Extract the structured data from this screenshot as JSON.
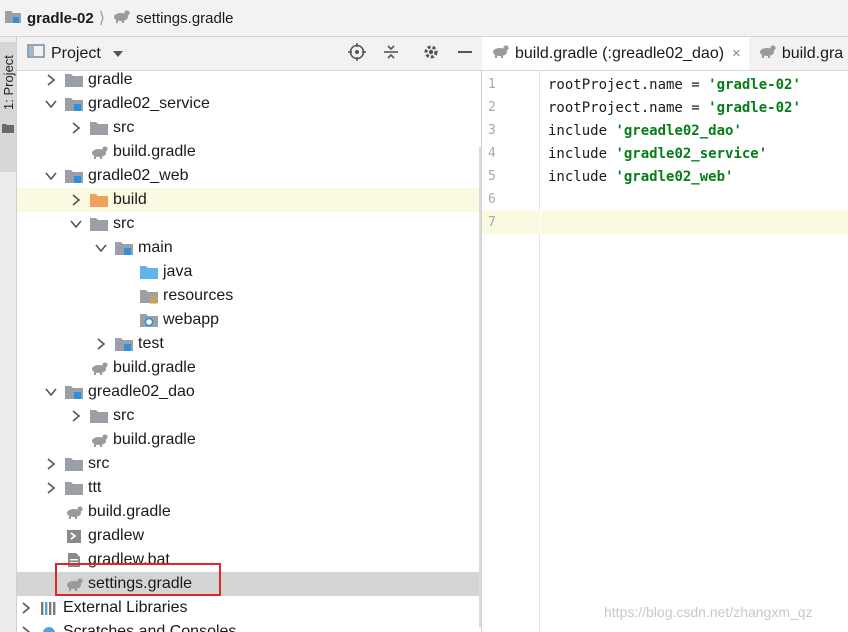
{
  "breadcrumb": {
    "project": "gradle-02",
    "file": "settings.gradle"
  },
  "tool_strip": {
    "project_tab": "1: Project"
  },
  "panel": {
    "title": "Project",
    "tree": [
      {
        "label": "gradle",
        "depth": 1,
        "arrow": "collapsed",
        "icon": "folder-icon"
      },
      {
        "label": "gradle02_service",
        "depth": 1,
        "arrow": "expanded",
        "icon": "module-folder-icon"
      },
      {
        "label": "src",
        "depth": 2,
        "arrow": "collapsed",
        "icon": "folder-icon"
      },
      {
        "label": "build.gradle",
        "depth": 2,
        "arrow": "none",
        "icon": "gradle-icon"
      },
      {
        "label": "gradle02_web",
        "depth": 1,
        "arrow": "expanded",
        "icon": "module-folder-icon"
      },
      {
        "label": "build",
        "depth": 2,
        "arrow": "collapsed",
        "icon": "excluded-folder-icon",
        "highlight": true
      },
      {
        "label": "src",
        "depth": 2,
        "arrow": "expanded",
        "icon": "folder-icon"
      },
      {
        "label": "main",
        "depth": 3,
        "arrow": "expanded",
        "icon": "module-folder-icon"
      },
      {
        "label": "java",
        "depth": 4,
        "arrow": "none",
        "icon": "source-folder-icon"
      },
      {
        "label": "resources",
        "depth": 4,
        "arrow": "none",
        "icon": "resources-folder-icon"
      },
      {
        "label": "webapp",
        "depth": 4,
        "arrow": "none",
        "icon": "web-folder-icon"
      },
      {
        "label": "test",
        "depth": 3,
        "arrow": "collapsed",
        "icon": "module-folder-icon"
      },
      {
        "label": "build.gradle",
        "depth": 2,
        "arrow": "none",
        "icon": "gradle-icon"
      },
      {
        "label": "greadle02_dao",
        "depth": 1,
        "arrow": "expanded",
        "icon": "module-folder-icon"
      },
      {
        "label": "src",
        "depth": 2,
        "arrow": "collapsed",
        "icon": "folder-icon"
      },
      {
        "label": "build.gradle",
        "depth": 2,
        "arrow": "none",
        "icon": "gradle-icon"
      },
      {
        "label": "src",
        "depth": 1,
        "arrow": "collapsed",
        "icon": "folder-icon"
      },
      {
        "label": "ttt",
        "depth": 1,
        "arrow": "collapsed",
        "icon": "folder-icon"
      },
      {
        "label": "build.gradle",
        "depth": 1,
        "arrow": "none",
        "icon": "gradle-icon"
      },
      {
        "label": "gradlew",
        "depth": 1,
        "arrow": "none",
        "icon": "script-icon"
      },
      {
        "label": "gradlew.bat",
        "depth": 1,
        "arrow": "none",
        "icon": "text-file-icon"
      },
      {
        "label": "settings.gradle",
        "depth": 1,
        "arrow": "none",
        "icon": "gradle-icon",
        "selected": true
      },
      {
        "label": "External Libraries",
        "depth": 0,
        "arrow": "collapsed",
        "icon": "libraries-icon"
      },
      {
        "label": "Scratches and Consoles",
        "depth": 0,
        "arrow": "collapsed",
        "icon": "scratches-icon"
      }
    ]
  },
  "editor": {
    "tabs": [
      {
        "label": "build.gradle (:greadle02_dao)",
        "close": "×",
        "active": true
      },
      {
        "label": "build.gra",
        "close": "",
        "active": false
      }
    ],
    "lines": [
      {
        "no": "1",
        "kw": "rootProject.name = ",
        "str": "'gradle-02'"
      },
      {
        "no": "2",
        "kw": "rootProject.name = ",
        "str": "'gradle-02'"
      },
      {
        "no": "3",
        "kw": "include ",
        "str": "'greadle02_dao'"
      },
      {
        "no": "4",
        "kw": "include ",
        "str": "'gradle02_service'"
      },
      {
        "no": "5",
        "kw": "include ",
        "str": "'gradle02_web'"
      },
      {
        "no": "6",
        "kw": "",
        "str": ""
      },
      {
        "no": "7",
        "kw": "",
        "str": ""
      }
    ],
    "current_line": 7
  },
  "watermark": "https://blog.csdn.net/zhangxm_qz",
  "colors": {
    "module_blue": "#2d8fe0",
    "folder_gray": "#9aa0a6",
    "excluded_orange": "#f0a15d",
    "string_green": "#067d17",
    "highlight": "#fafae0",
    "selection": "#d4d4d4",
    "annotation_red": "#e0252b"
  }
}
